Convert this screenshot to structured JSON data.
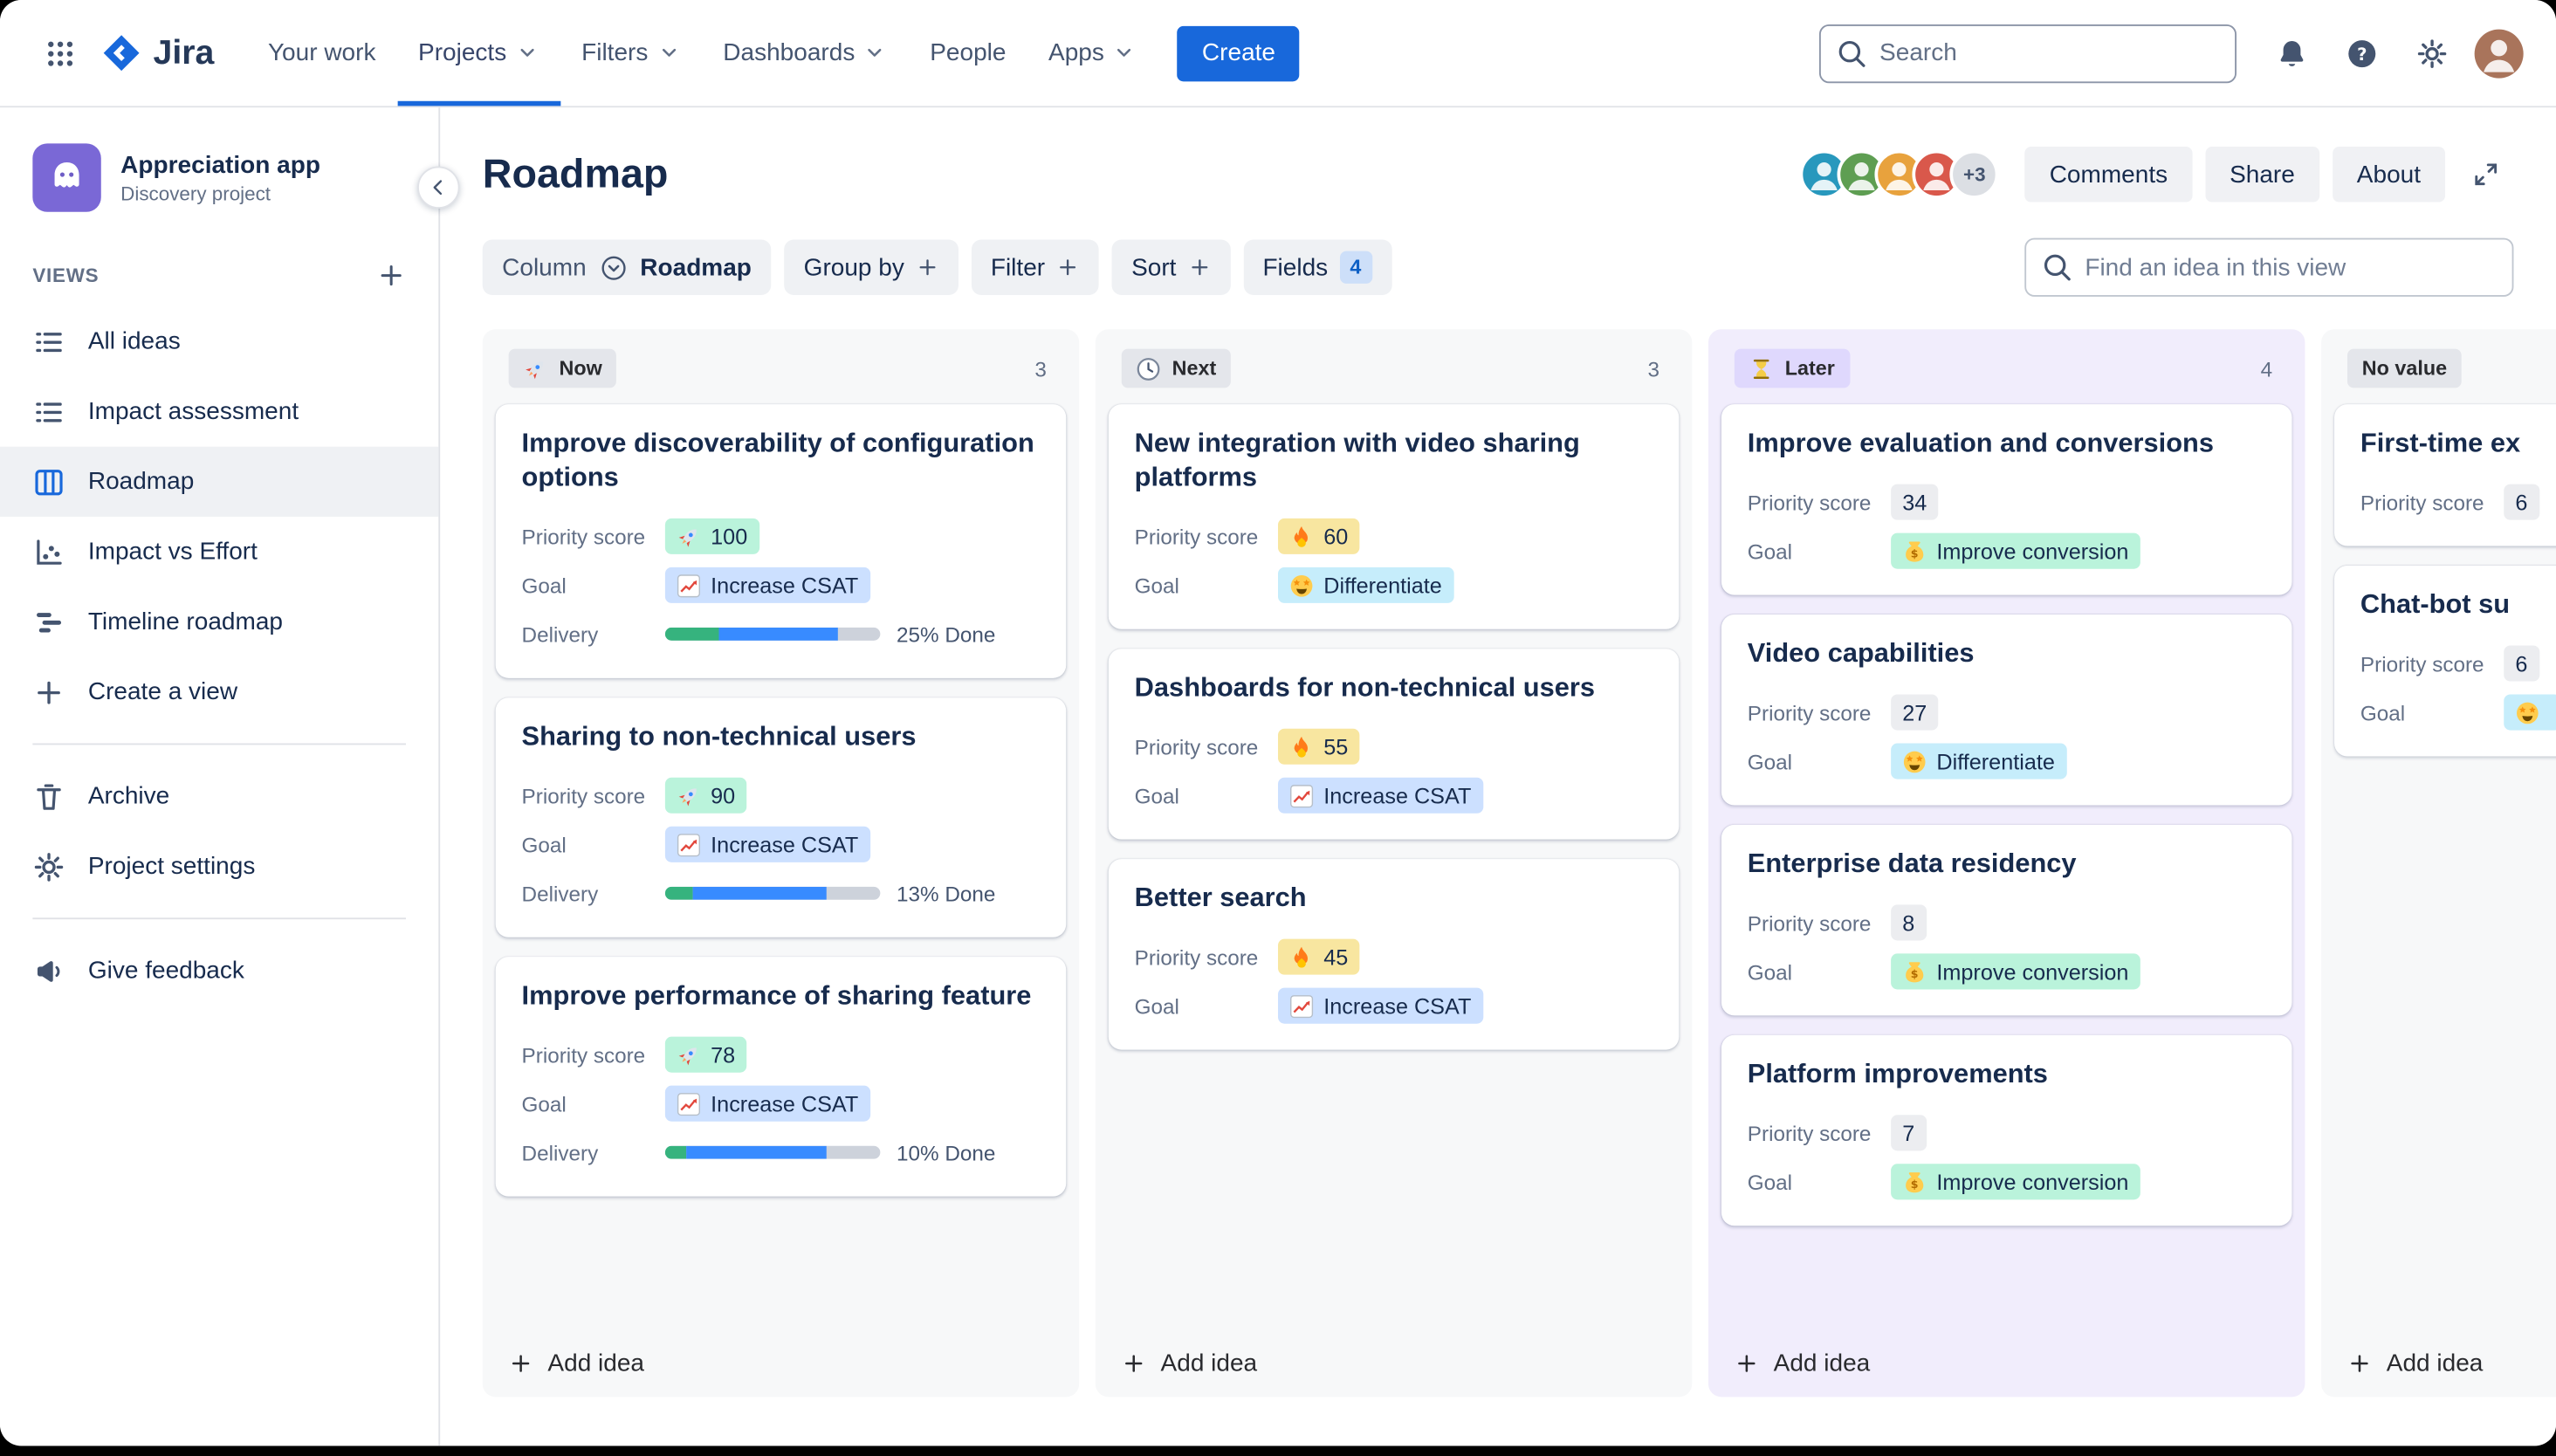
{
  "topnav": {
    "app_name": "Jira",
    "items": [
      {
        "label": "Your work",
        "dropdown": false
      },
      {
        "label": "Projects",
        "dropdown": true,
        "active": true
      },
      {
        "label": "Filters",
        "dropdown": true
      },
      {
        "label": "Dashboards",
        "dropdown": true
      },
      {
        "label": "People",
        "dropdown": false
      },
      {
        "label": "Apps",
        "dropdown": true
      }
    ],
    "create_button": "Create",
    "search_placeholder": "Search"
  },
  "icons": {
    "app_switcher": "grid",
    "logo": "jira-logo",
    "chevron_down": "chevron-down",
    "chevron_left": "chevron-left",
    "chevron_circle": "chevron-circle",
    "search": "search",
    "notifications": "bell",
    "help": "help",
    "settings": "gear",
    "plus": "plus",
    "expand": "expand",
    "person": "person",
    "project_avatar": "monster"
  },
  "sidebar": {
    "project_name": "Appreciation app",
    "project_type": "Discovery project",
    "views_label": "VIEWS",
    "views": [
      {
        "label": "All ideas",
        "icon": "list"
      },
      {
        "label": "Impact assessment",
        "icon": "list"
      },
      {
        "label": "Roadmap",
        "icon": "board",
        "active": true
      },
      {
        "label": "Impact vs Effort",
        "icon": "scatter"
      },
      {
        "label": "Timeline roadmap",
        "icon": "timeline"
      },
      {
        "label": "Create a view",
        "icon": "plus"
      }
    ],
    "tools": [
      {
        "label": "Archive",
        "icon": "trash"
      },
      {
        "label": "Project settings",
        "icon": "gear"
      }
    ],
    "feedback": {
      "label": "Give feedback",
      "icon": "megaphone"
    }
  },
  "header": {
    "title": "Roadmap",
    "avatar_overflow": "+3",
    "comments_button": "Comments",
    "share_button": "Share",
    "about_button": "About"
  },
  "toolbar": {
    "column_label": "Column",
    "column_value": "Roadmap",
    "group_by_label": "Group by",
    "filter_label": "Filter",
    "sort_label": "Sort",
    "fields_label": "Fields",
    "fields_count": "4",
    "find_placeholder": "Find an idea in this view"
  },
  "labels": {
    "priority_score": "Priority score",
    "goal": "Goal",
    "delivery": "Delivery"
  },
  "board": {
    "add_idea": "Add idea",
    "columns": [
      {
        "name": "Now",
        "icon": "rocket",
        "count": "3",
        "theme": "neutral",
        "cards": [
          {
            "title": "Improve discoverability of configuration options",
            "priority": {
              "icon": "rocket",
              "value": "100",
              "theme": "green"
            },
            "goal": {
              "icon": "chart-up",
              "label": "Increase CSAT",
              "theme": "blue"
            },
            "delivery": {
              "done": 25,
              "in_progress": 55,
              "label": "25% Done"
            }
          },
          {
            "title": "Sharing to non-technical users",
            "priority": {
              "icon": "rocket",
              "value": "90",
              "theme": "green"
            },
            "goal": {
              "icon": "chart-up",
              "label": "Increase CSAT",
              "theme": "blue"
            },
            "delivery": {
              "done": 13,
              "in_progress": 62,
              "label": "13% Done"
            }
          },
          {
            "title": "Improve performance of sharing feature",
            "priority": {
              "icon": "rocket",
              "value": "78",
              "theme": "green"
            },
            "goal": {
              "icon": "chart-up",
              "label": "Increase CSAT",
              "theme": "blue"
            },
            "delivery": {
              "done": 10,
              "in_progress": 65,
              "label": "10% Done"
            }
          }
        ]
      },
      {
        "name": "Next",
        "icon": "clock",
        "count": "3",
        "theme": "neutral",
        "cards": [
          {
            "title": "New integration with video sharing platforms",
            "priority": {
              "icon": "fire",
              "value": "60",
              "theme": "yellow"
            },
            "goal": {
              "icon": "star-struck",
              "label": "Differentiate",
              "theme": "cyan"
            }
          },
          {
            "title": "Dashboards for non-technical users",
            "priority": {
              "icon": "fire",
              "value": "55",
              "theme": "yellow"
            },
            "goal": {
              "icon": "chart-up",
              "label": "Increase CSAT",
              "theme": "blue"
            }
          },
          {
            "title": "Better search",
            "priority": {
              "icon": "fire",
              "value": "45",
              "theme": "yellow"
            },
            "goal": {
              "icon": "chart-up",
              "label": "Increase CSAT",
              "theme": "blue"
            }
          }
        ]
      },
      {
        "name": "Later",
        "icon": "hourglass",
        "count": "4",
        "theme": "purple",
        "cards": [
          {
            "title": "Improve evaluation and conversions",
            "priority": {
              "value": "34",
              "theme": "gray"
            },
            "goal": {
              "icon": "money",
              "label": "Improve conversion",
              "theme": "green"
            }
          },
          {
            "title": "Video capabilities",
            "priority": {
              "value": "27",
              "theme": "gray"
            },
            "goal": {
              "icon": "star-struck",
              "label": "Differentiate",
              "theme": "cyan"
            }
          },
          {
            "title": "Enterprise data residency",
            "priority": {
              "value": "8",
              "theme": "gray"
            },
            "goal": {
              "icon": "money",
              "label": "Improve conversion",
              "theme": "green"
            }
          },
          {
            "title": "Platform improvements",
            "priority": {
              "value": "7",
              "theme": "gray"
            },
            "goal": {
              "icon": "money",
              "label": "Improve conversion",
              "theme": "green"
            }
          }
        ]
      },
      {
        "name": "No value",
        "count": "",
        "theme": "neutral",
        "cards": [
          {
            "title": "First-time ex",
            "priority": {
              "value": "6",
              "theme": "gray"
            }
          },
          {
            "title": "Chat-bot su",
            "priority": {
              "value": "6",
              "theme": "gray"
            },
            "goal": {
              "icon": "star-struck",
              "label": "",
              "theme": "cyan"
            }
          }
        ]
      }
    ]
  },
  "colors": {
    "brand_blue": "#1868DB",
    "chip_blue": "#CCE0FF",
    "chip_cyan": "#C6EDFB",
    "chip_green": "#BAF3DB",
    "chip_yellow": "#F8E6A0",
    "chip_gray": "#ECEDF0",
    "status_purple_chip": "#DFD8FD",
    "column_bg": "#F7F8F9",
    "column_purple_bg": "#F1EDFC",
    "progress_done_green": "#36B37E",
    "progress_inprogress_blue": "#388BFF",
    "project_avatar_purple": "#7A68D6"
  }
}
